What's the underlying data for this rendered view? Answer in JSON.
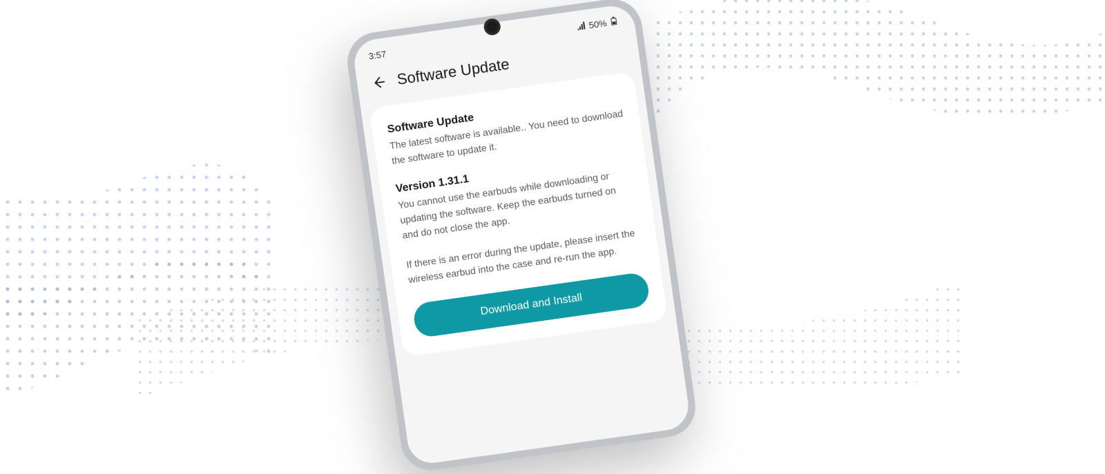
{
  "statusBar": {
    "time": "3:57",
    "batteryPercent": "50%"
  },
  "header": {
    "title": "Software Update"
  },
  "content": {
    "mainHeading": "Software Update",
    "mainBody": "The latest software is available.. You need to download the software to update it.",
    "versionHeading": "Version 1.31.1",
    "versionBody1": "You cannot use the earbuds while downloading or updating the software. Keep the earbuds turned on and do not close the app.",
    "versionBody2": "If there is an error during the update, please insert the wireless earbud into the case and re-run the app.",
    "ctaLabel": "Download and Install"
  },
  "colors": {
    "accent": "#0f99a5",
    "waveBlue": "#a9bfe4",
    "waveGrey": "#a0a5ad"
  }
}
